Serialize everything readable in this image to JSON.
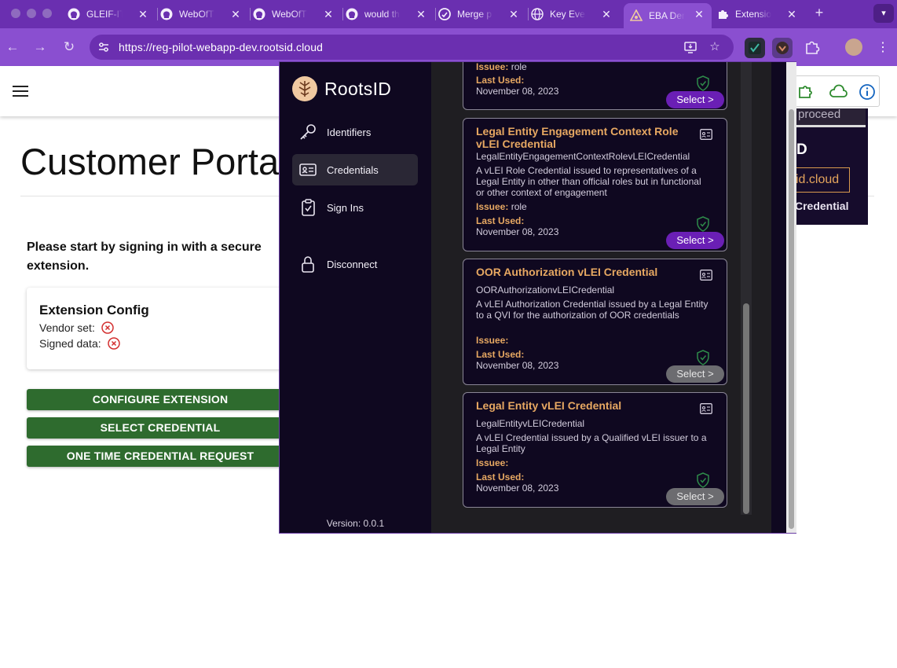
{
  "browser": {
    "tabs": [
      {
        "label": "GLEIF-IT",
        "icon": "github-icon"
      },
      {
        "label": "WebOfT",
        "icon": "github-icon"
      },
      {
        "label": "WebOfT",
        "icon": "github-icon"
      },
      {
        "label": "would th",
        "icon": "github-icon"
      },
      {
        "label": "Merge p",
        "icon": "github-icon"
      },
      {
        "label": "Key Ever",
        "icon": "globe-icon"
      },
      {
        "label": "EBA Der",
        "icon": "rootsid-icon",
        "active": true
      },
      {
        "label": "Extensio",
        "icon": "puzzle-icon"
      }
    ],
    "url": "https://reg-pilot-webapp-dev.rootsid.cloud",
    "colors": {
      "tabbar": "#6a2fb0",
      "toolbar": "#8a4fd0",
      "omnibox": "#6b2fb0"
    }
  },
  "page": {
    "title": "Customer Porta",
    "signin_message": "Please start by signing in with a secure extension.",
    "config_card": {
      "title": "Extension Config",
      "vendor_label": "Vendor set:",
      "signed_label": "Signed data:"
    },
    "buttons": {
      "configure": "CONFIGURE EXTENSION",
      "select": "SELECT CREDENTIAL",
      "one_time": "ONE TIME CREDENTIAL REQUEST"
    },
    "right_panel": {
      "proceed": "proceed",
      "label": "D",
      "url_fragment": "id.cloud",
      "credential": "Credential"
    },
    "colors": {
      "primary_button": "#2e6b2e",
      "error": "#d32f2f"
    }
  },
  "popup": {
    "brand": "RootsID",
    "nav": [
      {
        "label": "Identifiers",
        "icon": "key-icon"
      },
      {
        "label": "Credentials",
        "icon": "id-card-icon",
        "active": true
      },
      {
        "label": "Sign Ins",
        "icon": "clipboard-check-icon"
      },
      {
        "label": "Disconnect",
        "icon": "lock-icon"
      }
    ],
    "version": "Version: 0.0.1",
    "credentials": [
      {
        "issuee_label": "Issuee:",
        "issuee": "role",
        "last_used_label": "Last Used:",
        "last_used": "November 08, 2023",
        "select": "Select >",
        "enabled": true
      },
      {
        "title": "Legal Entity Engagement Context Role vLEI Credential",
        "type": "LegalEntityEngagementContextRolevLEICredential",
        "description": "A vLEI Role Credential issued to representatives of a Legal Entity in other than official roles but in functional or other context of engagement",
        "issuee_label": "Issuee:",
        "issuee": "role",
        "last_used_label": "Last Used:",
        "last_used": "November 08, 2023",
        "select": "Select >",
        "enabled": true
      },
      {
        "title": "OOR Authorization vLEI Credential",
        "type": "OORAuthorizationvLEICredential",
        "description": "A vLEI Authorization Credential issued by a Legal Entity to a QVI for the authorization of OOR credentials",
        "issuee_label": "Issuee:",
        "issuee": "",
        "last_used_label": "Last Used:",
        "last_used": "November 08, 2023",
        "select": "Select >",
        "enabled": false
      },
      {
        "title": "Legal Entity vLEI Credential",
        "type": "LegalEntityvLEICredential",
        "description": "A vLEI Credential issued by a Qualified vLEI issuer to a Legal Entity",
        "issuee_label": "Issuee:",
        "issuee": "",
        "last_used_label": "Last Used:",
        "last_used": "November 08, 2023",
        "select": "Select >",
        "enabled": false
      }
    ],
    "colors": {
      "accent": "#e7a862",
      "select_enabled": "#6a1fb5",
      "select_disabled": "#6c6c70",
      "sidebar": "#0f0820"
    }
  }
}
